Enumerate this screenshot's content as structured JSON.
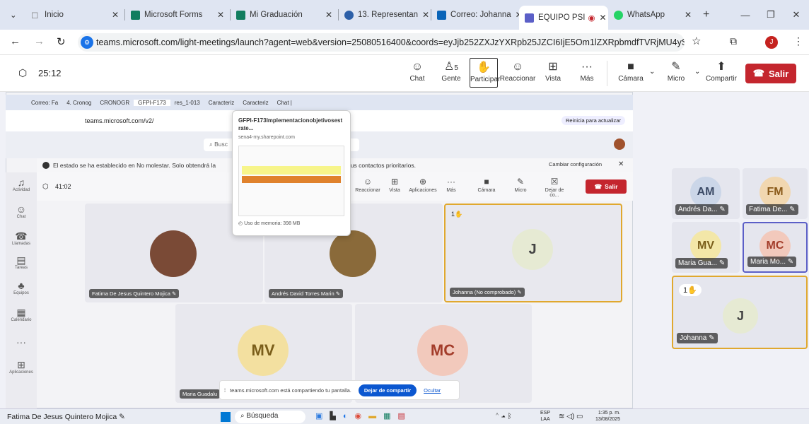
{
  "browser_tabs": [
    {
      "label": "Inicio",
      "color": "#777"
    },
    {
      "label": "Microsoft Forms",
      "color": "#117d5f"
    },
    {
      "label": "Mi Graduación",
      "color": "#117d5f"
    },
    {
      "label": "13. Representan",
      "color": "#2c5fa8"
    },
    {
      "label": "Correo: Johanna",
      "color": "#0a64b8"
    },
    {
      "label": "EQUIPO PSI",
      "color": "#5b5fc7"
    },
    {
      "label": "WhatsApp",
      "color": "#25d366"
    }
  ],
  "address_bar": {
    "url": "teams.microsoft.com/light-meetings/launch?agent=web&version=25080516400&coords=eyJjb252ZXJzYXRpb25JZCI6IjE5Om1lZXRpbmdfTVRjMU4ySXpaamd0WkRF..."
  },
  "meeting_toolbar": {
    "timer": "25:12",
    "chat": "Chat",
    "people": "Gente",
    "people_count": "5",
    "raise": "Participar",
    "react": "Reaccionar",
    "view": "Vista",
    "more": "Más",
    "camera": "Cámara",
    "mic": "Micro",
    "share": "Compartir",
    "leave": "Salir"
  },
  "inner_window": {
    "tabs": [
      "Correo: Fa",
      "4. Cronog",
      "CRONOGR",
      "GFPI-F173",
      "res_1-013",
      "Caracteriz",
      "Caracteriz",
      "Chat |"
    ],
    "url": "teams.microsoft.com/v2/",
    "update_btn": "Reinicia para actualizar",
    "search_placeholder": "Busc",
    "notice_left": "El estado se ha establecido en No molestar. Solo obtendrá la",
    "notice_right": "s de sus contactos prioritarios.",
    "change_config": "Cambiar configuración",
    "timer": "41:02",
    "tool": {
      "react": "Reaccionar",
      "view": "Vista",
      "apps": "Aplicaciones",
      "more": "Más",
      "camera": "Cámara",
      "mic": "Micro",
      "share": "Dejar de co...",
      "leave": "Salir"
    },
    "rail": [
      "Actividad",
      "Chat",
      "Llamadas",
      "Tareas",
      "Equipos",
      "Calendario",
      "Aplicaciones"
    ],
    "popup": {
      "title": "GFPI-F173Implementacionobjetivosestrate...",
      "domain": "sena4-my.sharepoint.com",
      "memory": "Uso de memoria: 398 MB"
    },
    "tiles": {
      "fatima": "Fatima De Jesus Quintero Mojica",
      "andres": "Andrés David Torres Marin",
      "johanna": "Johanna (No comprobado)",
      "maria_g": "Maria Guadalu",
      "mv": "MV",
      "mc": "MC",
      "j": "J",
      "hand": "1"
    },
    "share_bar": {
      "text": "teams.microsoft.com está compartiendo tu pantalla.",
      "stop": "Dejar de compartir",
      "hide": "Ocultar"
    }
  },
  "right_panel": [
    {
      "initials": "AM",
      "name": "Andrés Da..."
    },
    {
      "initials": "FM",
      "name": "Fatima De..."
    },
    {
      "initials": "MV",
      "name": "Maria Gua..."
    },
    {
      "initials": "MC",
      "name": "Maria Mo..."
    },
    {
      "initials": "J",
      "name": "Johanna",
      "hand": "1"
    }
  ],
  "taskbar": {
    "presenter": "Fatima De Jesus Quintero Mojica",
    "search": "Búsqueda",
    "lang": "ESP",
    "lang2": "LAA",
    "time": "1:35 p. m.",
    "date": "13/08/2025"
  }
}
